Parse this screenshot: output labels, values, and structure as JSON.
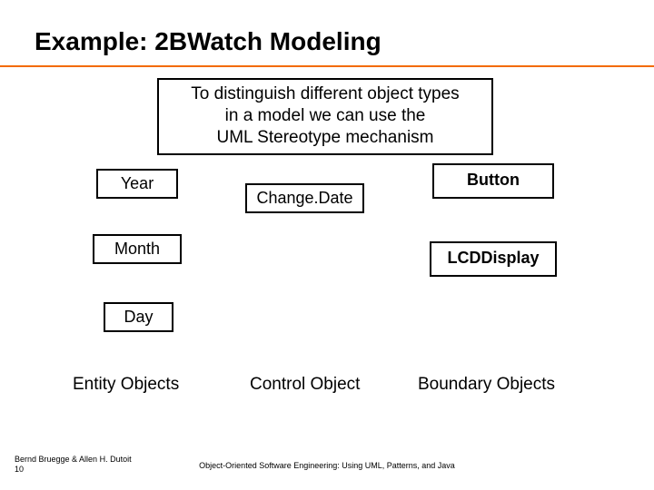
{
  "title": "Example: 2BWatch Modeling",
  "callout": {
    "line1": "To distinguish different object types",
    "line2": "in a model we can use the",
    "line3": "UML Stereotype mechanism"
  },
  "boxes": {
    "year": "Year",
    "month": "Month",
    "day": "Day",
    "changeDate": "Change.Date",
    "button": "Button",
    "lcd": "LCDDisplay"
  },
  "columns": {
    "entity": "Entity Objects",
    "control": "Control Object",
    "boundary": "Boundary Objects"
  },
  "footer": {
    "authors": "Bernd Bruegge & Allen H. Dutoit",
    "page": "10",
    "subtitle": "Object-Oriented Software Engineering: Using UML, Patterns, and Java"
  }
}
